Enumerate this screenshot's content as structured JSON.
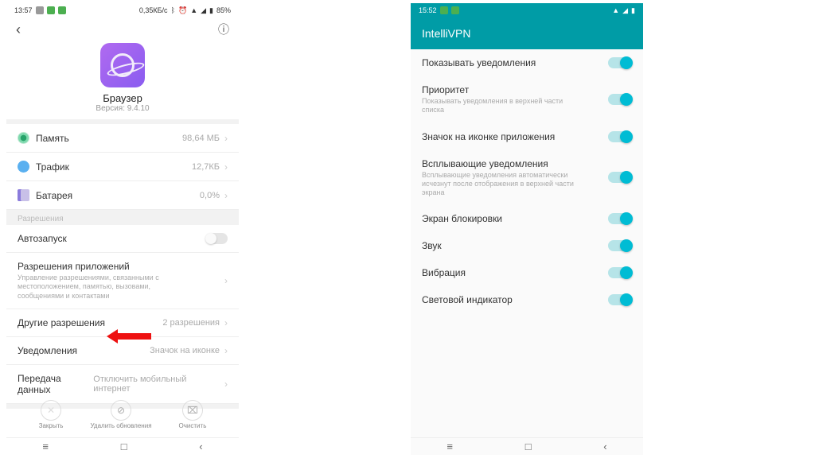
{
  "left": {
    "status": {
      "time": "13:57",
      "net": "0,35КБ/с",
      "batt": "85%"
    },
    "app": {
      "name": "Браузер",
      "version": "Версия: 9.4.10"
    },
    "metrics": {
      "memory": {
        "label": "Память",
        "value": "98,64 МБ"
      },
      "traffic": {
        "label": "Трафик",
        "value": "12,7КБ"
      },
      "battery": {
        "label": "Батарея",
        "value": "0,0%"
      }
    },
    "section_permissions": "Разрешения",
    "rows": {
      "autostart": {
        "label": "Автозапуск"
      },
      "permissions": {
        "title": "Разрешения приложений",
        "sub": "Управление разрешениями, связанными с местоположением, памятью, вызовами, сообщениями и контактами"
      },
      "other": {
        "title": "Другие разрешения",
        "value": "2 разрешения"
      },
      "notifications": {
        "title": "Уведомления",
        "value": "Значок на иконке"
      },
      "data": {
        "title": "Передача данных",
        "value": "Отключить мобильный интернет"
      }
    },
    "actions": {
      "close": "Закрыть",
      "uninstall": "Удалить обновления",
      "clear": "Очистить"
    }
  },
  "right": {
    "status": {
      "time": "15:52"
    },
    "title": "IntelliVPN",
    "items": [
      {
        "title": "Показывать уведомления",
        "sub": ""
      },
      {
        "title": "Приоритет",
        "sub": "Показывать уведомления в верхней части списка"
      },
      {
        "title": "Значок на иконке приложения",
        "sub": ""
      },
      {
        "title": "Всплывающие уведомления",
        "sub": "Всплывающие уведомления автоматически исчезнут после отображения в верхней части экрана"
      },
      {
        "title": "Экран блокировки",
        "sub": ""
      },
      {
        "title": "Звук",
        "sub": ""
      },
      {
        "title": "Вибрация",
        "sub": ""
      },
      {
        "title": "Световой индикатор",
        "sub": ""
      }
    ]
  }
}
